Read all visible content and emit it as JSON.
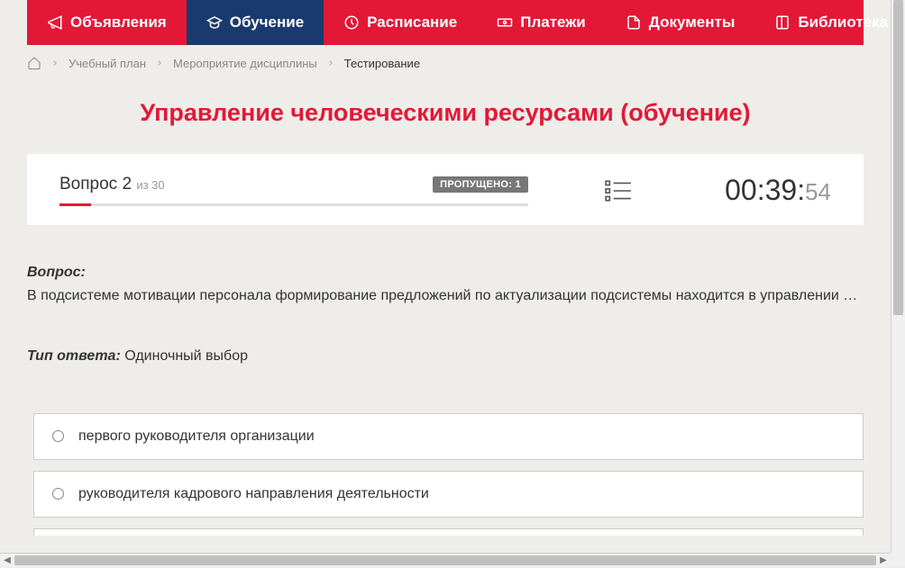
{
  "nav": {
    "items": [
      {
        "label": "Объявления",
        "active": false
      },
      {
        "label": "Обучение",
        "active": true
      },
      {
        "label": "Расписание",
        "active": false
      },
      {
        "label": "Платежи",
        "active": false
      },
      {
        "label": "Документы",
        "active": false
      },
      {
        "label": "Библиотека",
        "active": false,
        "hasDropdown": true
      }
    ]
  },
  "breadcrumb": {
    "items": [
      {
        "label": "Учебный план"
      },
      {
        "label": "Мероприятие дисциплины"
      },
      {
        "label": "Тестирование",
        "current": true
      }
    ]
  },
  "page": {
    "title": "Управление человеческими ресурсами (обучение)"
  },
  "status": {
    "question_word": "Вопрос",
    "question_number": "2",
    "question_of_word": "из",
    "question_total": "30",
    "skipped_label": "ПРОПУЩЕНО: 1",
    "timer_main": "00:39:",
    "timer_seconds": "54"
  },
  "question": {
    "label": "Вопрос:",
    "text": "В подсистеме мотивации персонала формирование предложений по актуализации подсистемы находится в управлении …",
    "answer_type_label": "Тип ответа:",
    "answer_type_value": "Одиночный выбор"
  },
  "answers": [
    {
      "text": "первого руководителя организации"
    },
    {
      "text": "руководителя кадрового направления деятельности"
    }
  ]
}
